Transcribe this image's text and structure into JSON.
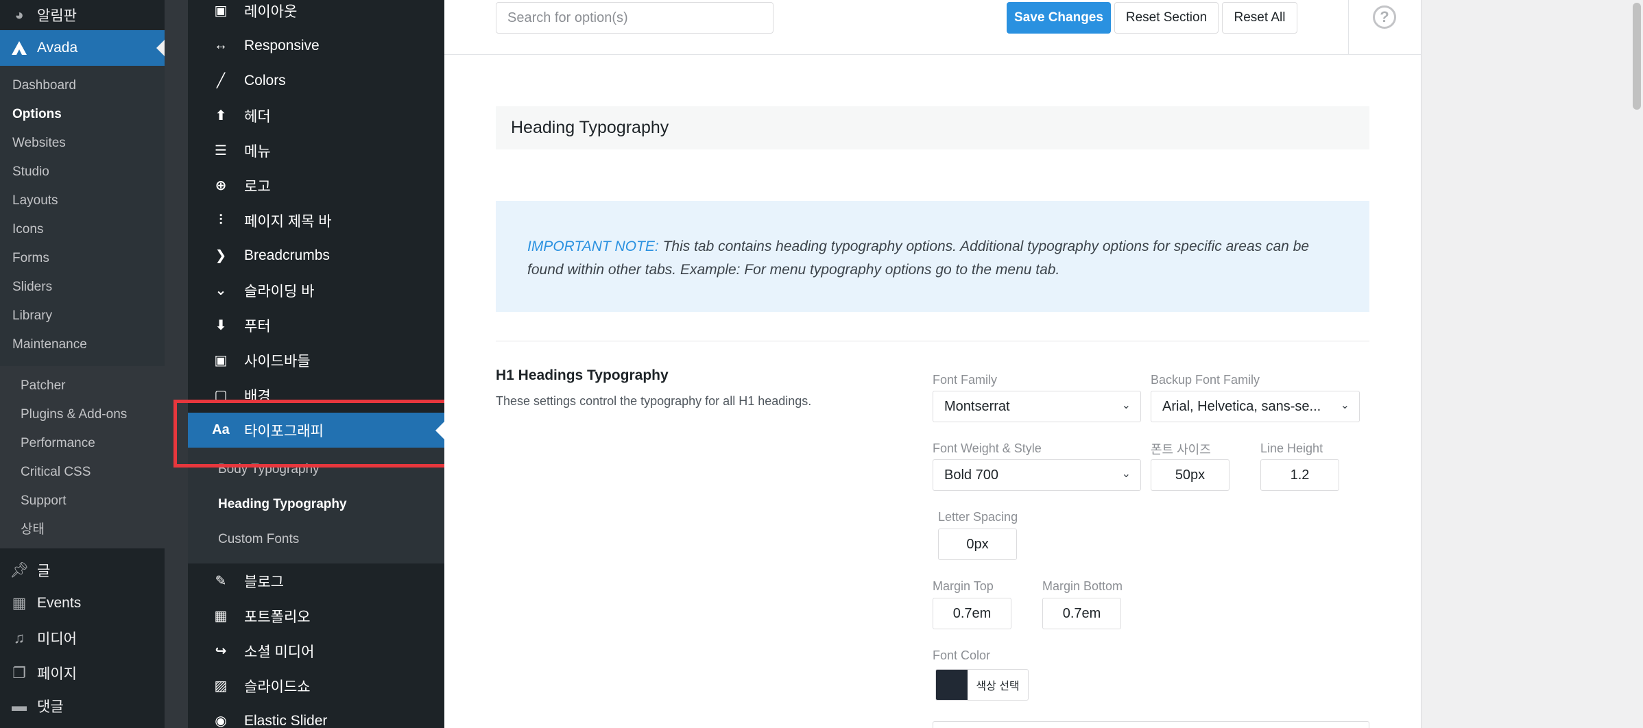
{
  "wp_menu": {
    "dashboard": "알림판",
    "avada": "Avada",
    "avada_sub": [
      "Dashboard",
      "Options",
      "Websites",
      "Studio",
      "Layouts",
      "Icons",
      "Forms",
      "Sliders",
      "Library",
      "Maintenance"
    ],
    "avada_sub_current": "Options",
    "maintenance_sub": [
      "Patcher",
      "Plugins & Add-ons",
      "Performance",
      "Critical CSS",
      "Support",
      "상태"
    ],
    "bottom": [
      {
        "label": "글",
        "icon": "pin-icon"
      },
      {
        "label": "Events",
        "icon": "calendar-icon"
      },
      {
        "label": "미디어",
        "icon": "media-icon"
      },
      {
        "label": "페이지",
        "icon": "pages-icon"
      },
      {
        "label": "댓글",
        "icon": "comments-icon"
      }
    ]
  },
  "options_nav": {
    "top_items": [
      {
        "label": "레이아웃",
        "icon": "layout-icon",
        "glyph": "▣"
      },
      {
        "label": "Responsive",
        "icon": "arrows-horizontal-icon",
        "glyph": "↔"
      },
      {
        "label": "Colors",
        "icon": "brush-icon",
        "glyph": "╱"
      },
      {
        "label": "헤더",
        "icon": "arrow-up-icon",
        "glyph": "⬆"
      },
      {
        "label": "메뉴",
        "icon": "menu-icon",
        "glyph": "☰"
      },
      {
        "label": "로고",
        "icon": "plus-circle-icon",
        "glyph": "⊕"
      },
      {
        "label": "페이지 제목 바",
        "icon": "sliders-icon",
        "glyph": "⫶"
      },
      {
        "label": "Breadcrumbs",
        "icon": "chevron-right-icon",
        "glyph": "❯"
      },
      {
        "label": "슬라이딩 바",
        "icon": "chevron-down-icon",
        "glyph": "⌄"
      },
      {
        "label": "푸터",
        "icon": "arrow-down-icon",
        "glyph": "⬇"
      },
      {
        "label": "사이드바들",
        "icon": "sidebar-icon",
        "glyph": "▣"
      },
      {
        "label": "배경",
        "icon": "background-icon",
        "glyph": "▢"
      }
    ],
    "active": {
      "label": "타이포그래피",
      "icon": "typography-icon",
      "glyph": "Aa"
    },
    "sub_items": [
      "Body Typography",
      "Heading Typography",
      "Custom Fonts"
    ],
    "sub_current": "Heading Typography",
    "bottom_items": [
      {
        "label": "블로그",
        "icon": "edit-icon",
        "glyph": "✎"
      },
      {
        "label": "포트폴리오",
        "icon": "grid-icon",
        "glyph": "▦"
      },
      {
        "label": "소셜 미디어",
        "icon": "share-icon",
        "glyph": "↪"
      },
      {
        "label": "슬라이드쇼",
        "icon": "image-icon",
        "glyph": "▨"
      },
      {
        "label": "Elastic Slider",
        "icon": "slider-icon",
        "glyph": "◉"
      }
    ]
  },
  "toolbar": {
    "search_placeholder": "Search for option(s)",
    "save": "Save Changes",
    "reset_section": "Reset Section",
    "reset_all": "Reset All",
    "help": "?"
  },
  "content": {
    "section_title": "Heading Typography",
    "note_label": "IMPORTANT NOTE:",
    "note_text": " This tab contains heading typography options. Additional typography options for specific areas can be found within other tabs. Example: For menu typography options go to the menu tab.",
    "h1_title": "H1 Headings Typography",
    "h1_desc": "These settings control the typography for all H1 headings.",
    "fields": {
      "font_family_label": "Font Family",
      "font_family_value": "Montserrat",
      "backup_font_label": "Backup Font Family",
      "backup_font_value": "Arial, Helvetica, sans-se...",
      "weight_label": "Font Weight & Style",
      "weight_value": "Bold 700",
      "size_label": "폰트 사이즈",
      "size_value": "50px",
      "line_height_label": "Line Height",
      "line_height_value": "1.2",
      "letter_spacing_label": "Letter Spacing",
      "letter_spacing_value": "0px",
      "margin_top_label": "Margin Top",
      "margin_top_value": "0.7em",
      "margin_bottom_label": "Margin Bottom",
      "margin_bottom_value": "0.7em",
      "font_color_label": "Font Color",
      "font_color_button": "색상 선택",
      "font_color_value": "#212934"
    }
  },
  "colors": {
    "accent": "#2a91e0",
    "wp_active": "#2271b1",
    "highlight": "#e8373d"
  }
}
